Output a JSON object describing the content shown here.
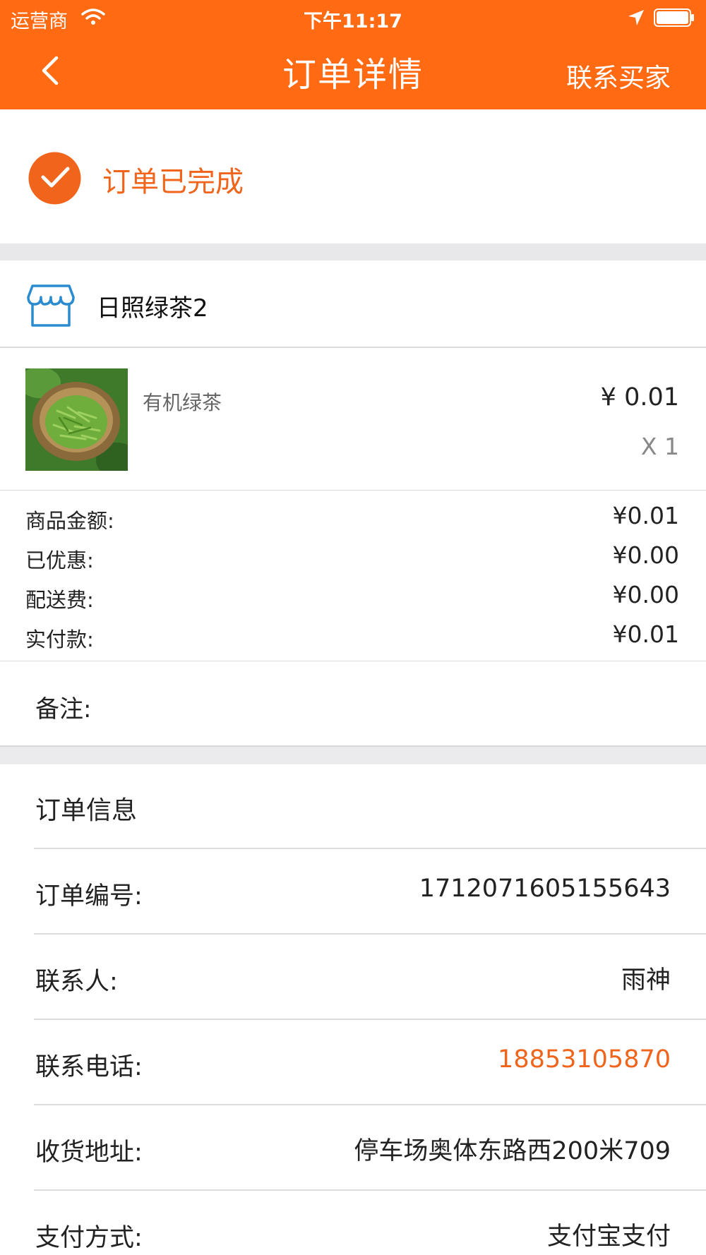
{
  "status_bar": {
    "carrier": "运营商",
    "time": "下午11:17"
  },
  "nav": {
    "title": "订单详情",
    "contact_buyer": "联系买家"
  },
  "order_status": {
    "text": "订单已完成"
  },
  "store": {
    "name": "日照绿茶2"
  },
  "product": {
    "name": "有机绿茶",
    "price": "¥ 0.01",
    "quantity": "X 1"
  },
  "summary": [
    {
      "label": "商品金额:",
      "value": "¥0.01"
    },
    {
      "label": "已优惠:",
      "value": "¥0.00"
    },
    {
      "label": "配送费:",
      "value": "¥0.00"
    },
    {
      "label": "实付款:",
      "value": "¥0.01"
    }
  ],
  "remark": {
    "label": "备注:"
  },
  "order_info": {
    "header": "订单信息",
    "rows": [
      {
        "label": "订单编号:",
        "value": "1712071605155643"
      },
      {
        "label": "联系人:",
        "value": "雨神"
      },
      {
        "label": "联系电话:",
        "value": "18853105870"
      },
      {
        "label": "收货地址:",
        "value": "停车场奥体东路西200米709"
      },
      {
        "label": "支付方式:",
        "value": "支付宝支付"
      }
    ]
  },
  "colors": {
    "accent": "#ff6a13",
    "status_text": "#f0641b",
    "phone": "#f0641b"
  }
}
